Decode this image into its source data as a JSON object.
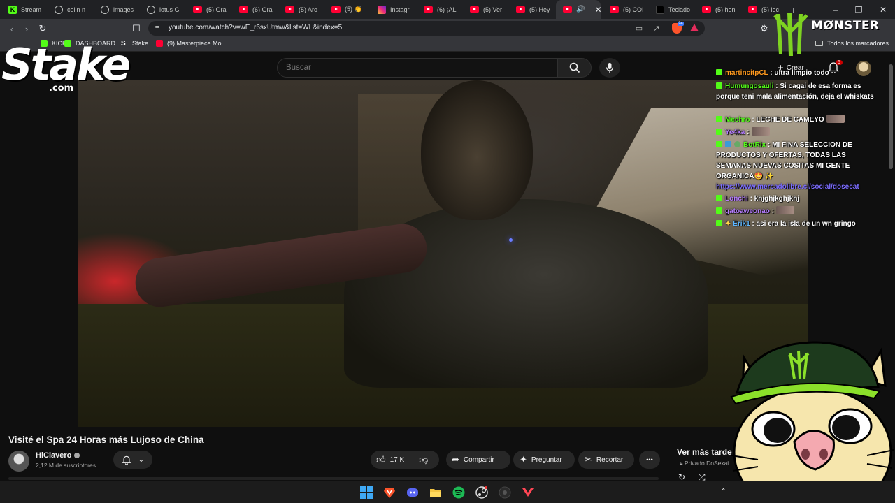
{
  "browser": {
    "tabs": [
      {
        "label": "Stream",
        "icon": "kick-icon",
        "active": false
      },
      {
        "label": "colin n",
        "icon": "globe-icon",
        "active": false
      },
      {
        "label": "images",
        "icon": "globe-icon",
        "active": false
      },
      {
        "label": "lotus G",
        "icon": "globe-icon",
        "active": false
      },
      {
        "label": "(5) Gra",
        "icon": "youtube-icon",
        "active": false
      },
      {
        "label": "(6) Gra",
        "icon": "youtube-icon",
        "active": false
      },
      {
        "label": "(5) Arc",
        "icon": "youtube-icon",
        "active": false
      },
      {
        "label": "(5) 👏",
        "icon": "youtube-icon",
        "active": false
      },
      {
        "label": "Instagr",
        "icon": "instagram-icon",
        "active": false
      },
      {
        "label": "(6) ¡AL",
        "icon": "youtube-icon",
        "active": false
      },
      {
        "label": "(5) Ver",
        "icon": "youtube-icon",
        "active": false
      },
      {
        "label": "(5) Hey",
        "icon": "youtube-icon",
        "active": false
      },
      {
        "label": "",
        "icon": "youtube-icon",
        "active": true
      },
      {
        "label": "(5) COI",
        "icon": "youtube-icon",
        "active": false
      },
      {
        "label": "Teclado",
        "icon": "page-icon",
        "active": false
      },
      {
        "label": "(5) hon",
        "icon": "youtube-icon",
        "active": false
      },
      {
        "label": "(5) loc",
        "icon": "youtube-icon",
        "active": false
      }
    ],
    "new_tab": "+",
    "url": "youtube.com/watch?v=wE_r6sxUtmw&list=WL&index=5",
    "brave_badge": "24",
    "bookmarks": [
      {
        "label": "KICK",
        "icon": "kick-icon"
      },
      {
        "label": "DASHBOARD",
        "icon": "kick-icon"
      },
      {
        "label": "Stake",
        "icon": "stake-icon"
      },
      {
        "label": "(9) Masterpiece Mo...",
        "icon": "youtube-icon"
      }
    ],
    "all_bookmarks": "Todos los marcadores"
  },
  "youtube": {
    "search_placeholder": "Buscar",
    "create_label": "Crear",
    "notification_count": "5",
    "video_title": "Visité el Spa 24 Horas más Lujoso de China",
    "channel_name": "HiClavero",
    "subscribers": "2,12 M de suscriptores",
    "likes": "17 K",
    "share_label": "Compartir",
    "ask_label": "Preguntar",
    "clip_label": "Recortar",
    "more_label": "•••",
    "watch_later_title": "Ver más tarde",
    "watch_later_privacy": "Privado DoSekai"
  },
  "chat": [
    {
      "user": "martincitpCL",
      "color": "#ff9a1f",
      "text": ": ultra limpio todo",
      "emote": false,
      "badges": 1
    },
    {
      "user": "Humungosauli",
      "color": "#53fc18",
      "text": ": Si cagai de esa forma es porque teni mala alimentación, deja el whiskats",
      "emote": false,
      "badges": 1
    },
    {
      "user": "Mechro",
      "color": "#53fc18",
      "text": ": LECHE DE CAMEYO",
      "emote": true,
      "badges": 1
    },
    {
      "user": "Ye4ka",
      "color": "#b57cff",
      "text": ":",
      "emote": true,
      "badges": 1
    },
    {
      "user": "BotRix",
      "color": "#53fc18",
      "text": ": MI FINA SELECCION DE PRODUCTOS Y OFERTAS, TODAS LAS SEMANAS NUEVAS COSITAS MI GENTE ORGANICA🤩 ✨",
      "link": "https://www.mercadolibre.cl/social/dosecat",
      "emote": false,
      "badges": 3
    },
    {
      "user": "Lonchi",
      "color": "#b57cff",
      "text": ": khjghjkghjkhj",
      "emote": false,
      "badges": 1
    },
    {
      "user": "gatoaweonao",
      "color": "#b57cff",
      "text": ":",
      "emote": true,
      "badges": 1
    },
    {
      "user": "Erik1",
      "color": "#5fb8ff",
      "text": ": asi era la isla de un wn gringo",
      "emote": false,
      "badges": 2
    }
  ],
  "overlay": {
    "stake_word": "Stake",
    "stake_com": ".com",
    "monster_word": "MØNSTER"
  },
  "taskbar": {
    "apps": [
      "windows-start-icon",
      "brave-icon",
      "discord-icon",
      "file-explorer-icon",
      "spotify-icon",
      "steam-icon",
      "obs-icon",
      "valorant-icon"
    ]
  }
}
